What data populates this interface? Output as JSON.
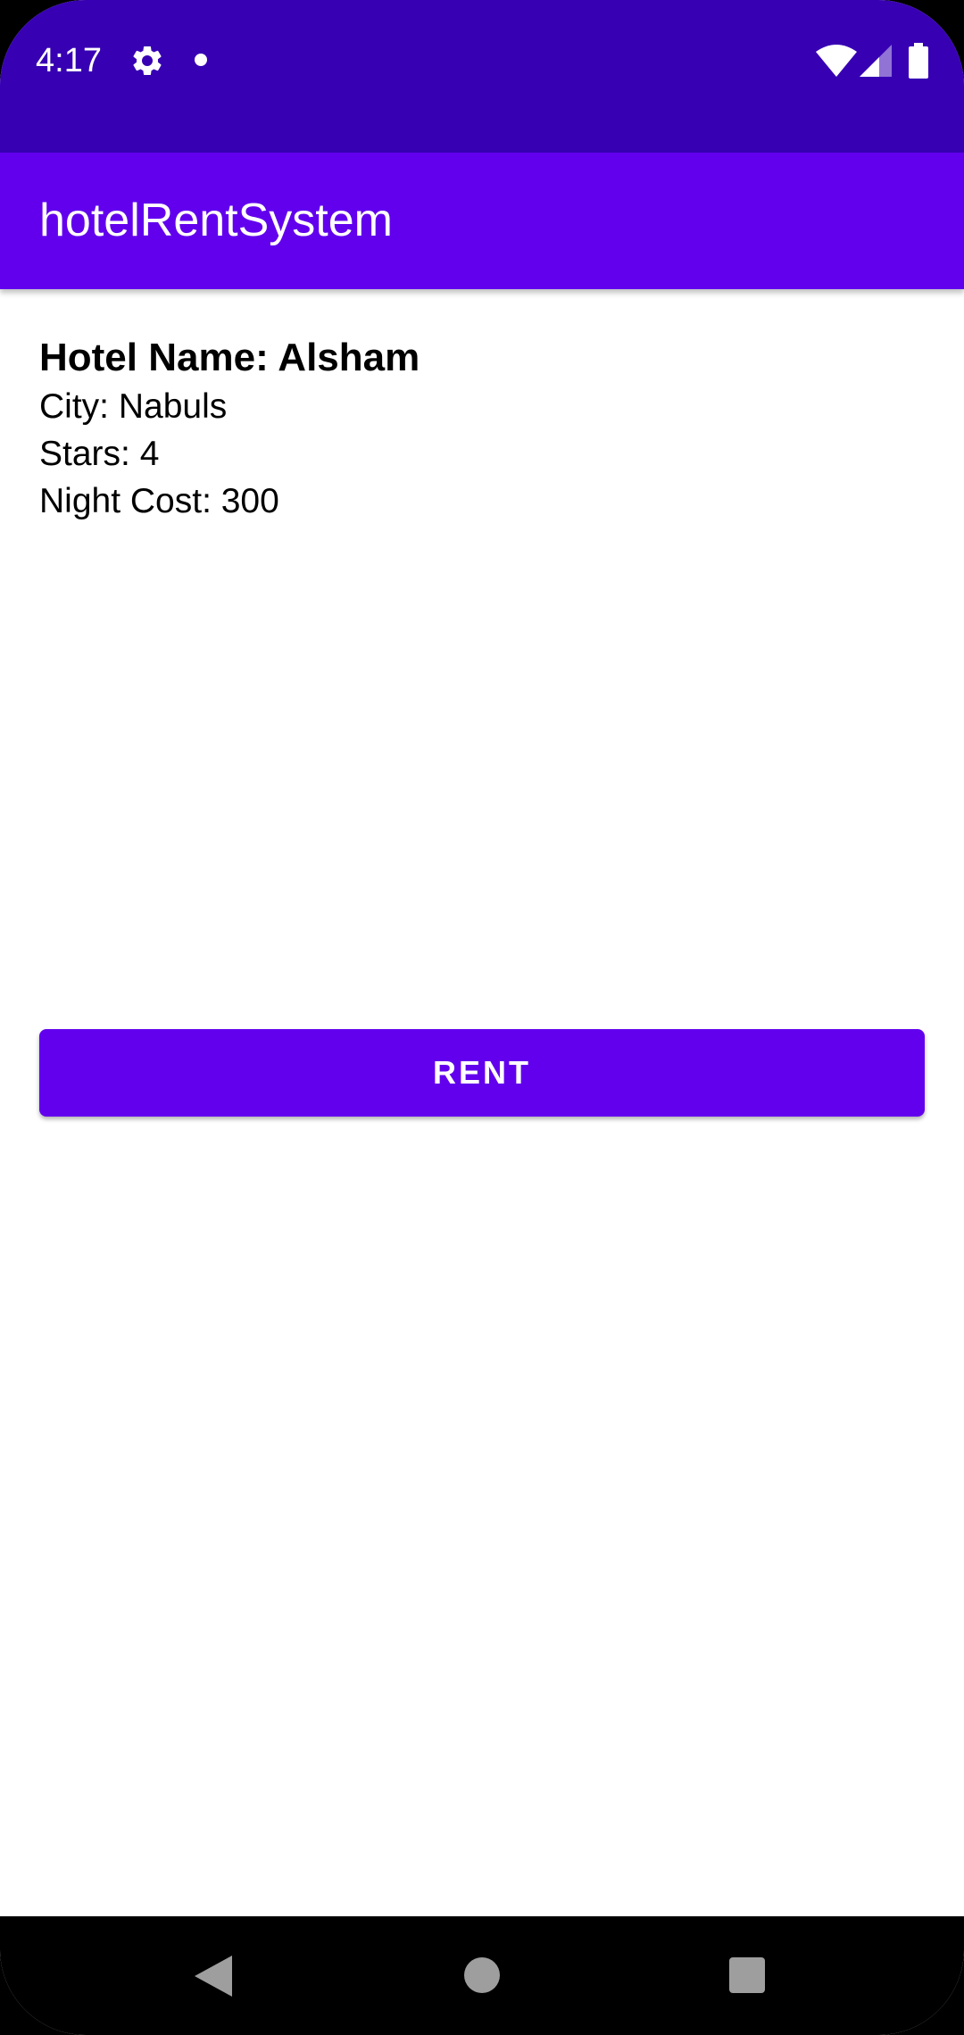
{
  "status_bar": {
    "time": "4:17",
    "icons": [
      "gear-icon",
      "notification-dot-icon",
      "wifi-icon",
      "cell-signal-icon",
      "battery-icon"
    ],
    "color": "#3700b3"
  },
  "app_bar": {
    "title": "hotelRentSystem",
    "color": "#6200ee"
  },
  "hotel": {
    "name_line": "Hotel Name: Alsham",
    "city_line": "City: Nabuls",
    "stars_line": "Stars: 4",
    "cost_line": "Night Cost: 300"
  },
  "actions": {
    "rent_label": "RENT",
    "color": "#6200ee"
  },
  "nav_bar": {
    "icons": [
      "back-icon",
      "home-icon",
      "recents-icon"
    ]
  }
}
